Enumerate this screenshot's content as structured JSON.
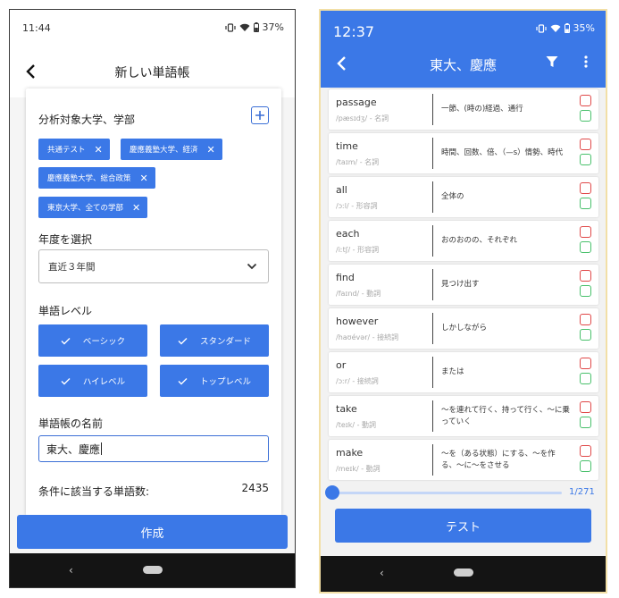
{
  "left": {
    "status": {
      "time": "11:44",
      "battery": "37%"
    },
    "title": "新しい単語帳",
    "universities_label": "分析対象大学、学部",
    "chips": [
      "共通テスト",
      "慶應義塾大学、経済",
      "慶應義塾大学、総合政策",
      "東京大学、全ての学部"
    ],
    "year_label": "年度を選択",
    "year_value": "直近３年間",
    "level_label": "単語レベル",
    "levels": [
      "ベーシック",
      "スタンダード",
      "ハイレベル",
      "トップレベル"
    ],
    "name_label": "単語帳の名前",
    "name_value": "東大、慶應",
    "count_label": "条件に該当する単語数:",
    "count_value": "2435",
    "create_label": "作成",
    "nav_back": "‹"
  },
  "right": {
    "status": {
      "time": "12:37",
      "battery": "35%"
    },
    "title": "東大、慶應",
    "words": [
      {
        "word": "passage",
        "pron": "/pæsɪdʒ/ - 名詞",
        "meaning": "一節、(時の)経過、通行"
      },
      {
        "word": "time",
        "pron": "/taɪm/ - 名詞",
        "meaning": "時間、回数、倍、（—s）情勢、時代"
      },
      {
        "word": "all",
        "pron": "/ɔːl/ - 形容詞",
        "meaning": "全体の"
      },
      {
        "word": "each",
        "pron": "/iːtʃ/ - 形容詞",
        "meaning": "おのおのの、それぞれ"
      },
      {
        "word": "find",
        "pron": "/faɪnd/ - 動詞",
        "meaning": "見つけ出す"
      },
      {
        "word": "however",
        "pron": "/haʊévər/ - 接続詞",
        "meaning": "しかしながら"
      },
      {
        "word": "or",
        "pron": "/ɔːr/ - 接続詞",
        "meaning": "または"
      },
      {
        "word": "take",
        "pron": "/teɪk/ - 動詞",
        "meaning": "〜を連れて行く、持って行く、〜に乗っていく"
      },
      {
        "word": "make",
        "pron": "/meɪk/ - 動詞",
        "meaning": "〜を（ある状態）にする、〜を作る、〜に〜をさせる"
      }
    ],
    "progress": {
      "label": "1/271",
      "current": 1,
      "total": 271
    },
    "test_label": "テスト",
    "nav_back": "‹"
  },
  "colors": {
    "accent": "#3b78e7",
    "tab_indicator": "#f08a2c",
    "wrong": "#e04848",
    "right": "#48c06b"
  }
}
